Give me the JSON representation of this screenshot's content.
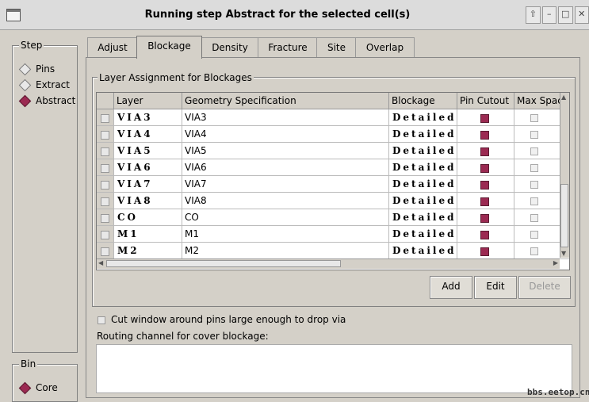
{
  "window": {
    "title": "Running step Abstract for the selected cell(s)",
    "buttons": [
      "⇧",
      "–",
      "□",
      "✕"
    ]
  },
  "step_group": {
    "label": "Step",
    "options": [
      {
        "label": "Pins",
        "selected": false
      },
      {
        "label": "Extract",
        "selected": false
      },
      {
        "label": "Abstract",
        "selected": true
      }
    ]
  },
  "bin_group": {
    "label": "Bin",
    "options": [
      {
        "label": "Core",
        "selected": true
      }
    ]
  },
  "tabs": [
    {
      "label": "Adjust",
      "active": false
    },
    {
      "label": "Blockage",
      "active": true
    },
    {
      "label": "Density",
      "active": false
    },
    {
      "label": "Fracture",
      "active": false
    },
    {
      "label": "Site",
      "active": false
    },
    {
      "label": "Overlap",
      "active": false
    }
  ],
  "layer_group": {
    "label": "Layer Assignment for Blockages",
    "columns": [
      "Layer",
      "Geometry Specification",
      "Blockage",
      "Pin Cutout",
      "Max Spac"
    ],
    "rows": [
      {
        "layer": "VIA3",
        "geometry": "VIA3",
        "blockage": "Detailed"
      },
      {
        "layer": "VIA4",
        "geometry": "VIA4",
        "blockage": "Detailed"
      },
      {
        "layer": "VIA5",
        "geometry": "VIA5",
        "blockage": "Detailed"
      },
      {
        "layer": "VIA6",
        "geometry": "VIA6",
        "blockage": "Detailed"
      },
      {
        "layer": "VIA7",
        "geometry": "VIA7",
        "blockage": "Detailed"
      },
      {
        "layer": "VIA8",
        "geometry": "VIA8",
        "blockage": "Detailed"
      },
      {
        "layer": "CO",
        "geometry": "CO",
        "blockage": "Detailed"
      },
      {
        "layer": "M1",
        "geometry": "M1",
        "blockage": "Detailed"
      },
      {
        "layer": "M2",
        "geometry": "M2",
        "blockage": "Detailed"
      }
    ],
    "buttons": {
      "add": "Add",
      "edit": "Edit",
      "delete": "Delete"
    }
  },
  "cut_window": {
    "label": "Cut window around pins large enough to drop via",
    "checked": false
  },
  "routing_channel": {
    "label": "Routing channel for cover blockage:",
    "value": ""
  },
  "watermark": "bbs.eetop.cn",
  "colors": {
    "accent": "#9b2a52",
    "background": "#d4d0c8"
  }
}
